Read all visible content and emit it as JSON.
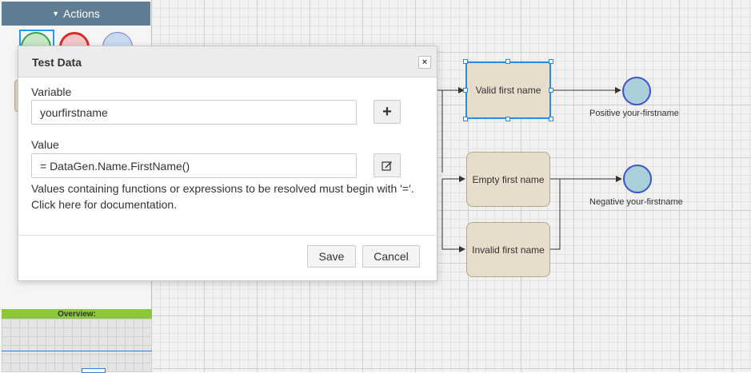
{
  "sidebar": {
    "actions_title": "Actions",
    "overview_label": "Overview:",
    "palette": [
      {
        "name": "start-event"
      },
      {
        "name": "end-event"
      },
      {
        "name": "intermediate-event"
      }
    ]
  },
  "diagram": {
    "nodes": {
      "valid": "Valid first name",
      "empty": "Empty first name",
      "invalid": "Invalid first name"
    },
    "end_events": {
      "positive": "Positive your-firstname",
      "negative": "Negative your-firstname"
    },
    "colors": {
      "task_fill": "#e8dccb",
      "selection": "#2a8ae6",
      "end_event_fill": "#a9cfd8",
      "end_event_stroke": "#3b54c8"
    }
  },
  "dialog": {
    "title": "Test Data",
    "close_icon": "×",
    "variable_label": "Variable",
    "variable_value": "yourfirstname",
    "add_icon": "+",
    "value_label": "Value",
    "value_value": "= DataGen.Name.FirstName()",
    "help_text": "Values containing functions or expressions to be resolved must begin with '='.",
    "doc_link": "Click here for documentation.",
    "save_label": "Save",
    "cancel_label": "Cancel"
  },
  "icons": {
    "close": "close-icon",
    "add": "plus-icon",
    "edit": "edit-icon",
    "caret": "caret-down-icon"
  }
}
